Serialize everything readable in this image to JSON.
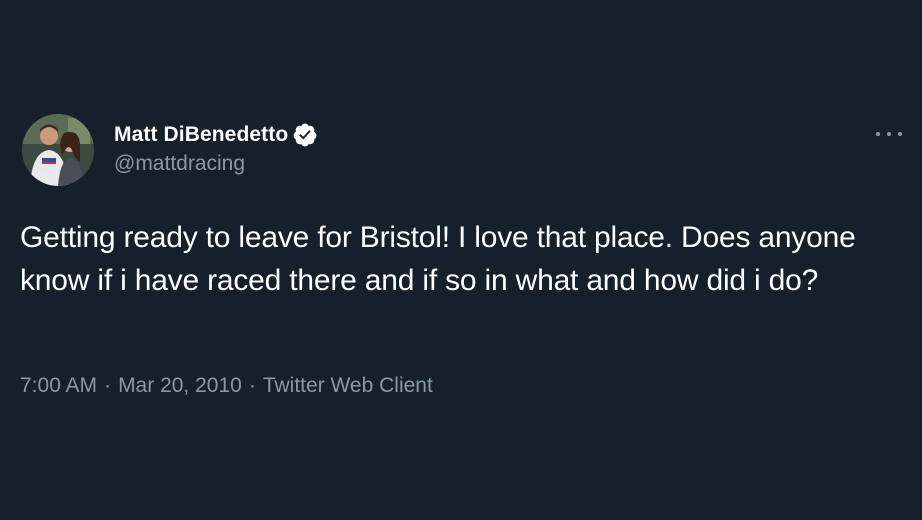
{
  "tweet": {
    "author": {
      "display_name": "Matt DiBenedetto",
      "handle": "@mattdracing",
      "verified": true
    },
    "text": "Getting ready to leave for Bristol! I love that place. Does anyone know if i have raced there and if so in what and how did i do?",
    "time": "7:00 AM",
    "date": "Mar 20, 2010",
    "client": "Twitter Web Client",
    "separator": "·"
  },
  "colors": {
    "background": "#15202b",
    "text_primary": "#ffffff",
    "text_secondary": "#8899a6",
    "verified_badge": "#ffffff"
  },
  "icons": {
    "verified": "verified-badge-icon",
    "more": "more-options-icon"
  }
}
